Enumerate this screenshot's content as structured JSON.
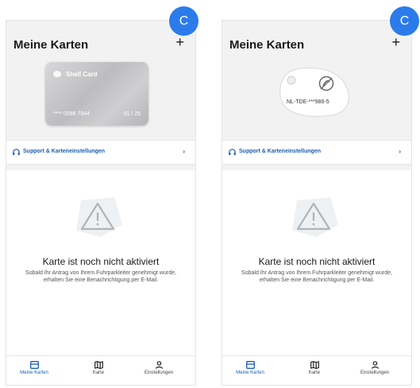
{
  "badge_letter": "C",
  "title": "Meine Karten",
  "add_symbol": "+",
  "card": {
    "brand": "Shell Card",
    "number": "**** 0088 7944",
    "expiry": "01 / 25"
  },
  "tag": {
    "label": "NL-TDE-***986-5"
  },
  "support": {
    "label": "Support & Karteneinstellungen",
    "chevron": "›"
  },
  "empty_state": {
    "title": "Karte ist noch nicht aktiviert",
    "text": "Sobald Ihr Antrag von Ihrem Fuhrparkleiter genehmigt wurde, erhalten Sie eine Benachrichtigung per E-Mail."
  },
  "tabs": [
    {
      "label": "Meine Karten",
      "icon": "card-icon",
      "active": true
    },
    {
      "label": "Karte",
      "icon": "map-icon",
      "active": false
    },
    {
      "label": "Einstellungen",
      "icon": "person-icon",
      "active": false
    }
  ],
  "colors": {
    "accent": "#1a5fb4",
    "badge": "#2b7bea",
    "background": "#f2f2f2"
  }
}
